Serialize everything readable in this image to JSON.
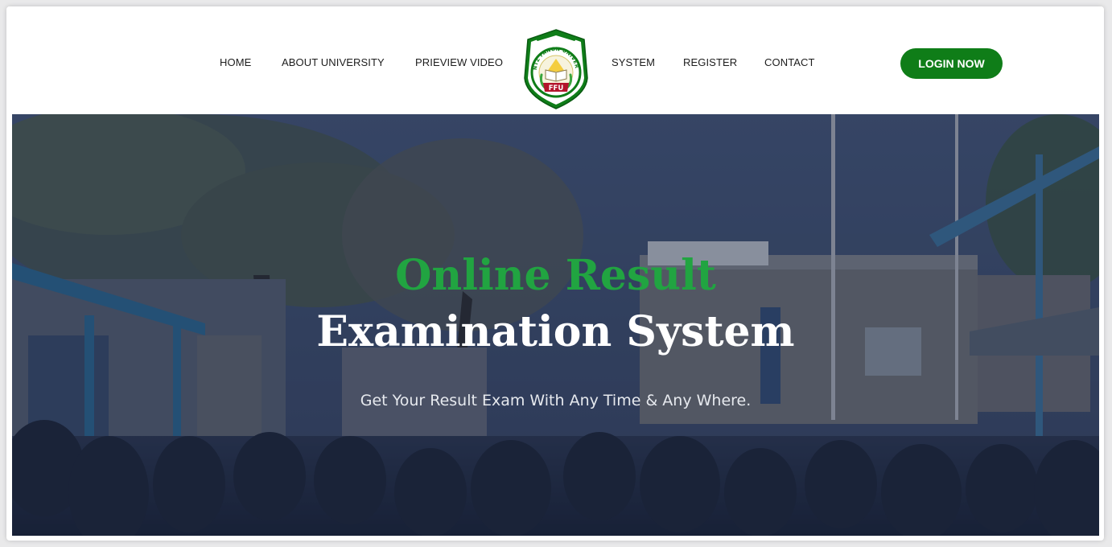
{
  "nav": {
    "home": "HOME",
    "about": "ABOUT UNIVERSITY",
    "preview": "PRIEVIEW VIDEO",
    "system": "SYSTEM",
    "register": "REGISTER",
    "contact": "CONTACT"
  },
  "logo": {
    "arc_text": "FRANTZ FANON UNIVERSITY",
    "initials": "FFU",
    "icon": "university-crest-icon"
  },
  "login_button": "LOGIN NOW",
  "hero": {
    "title_line1": "Online Result",
    "title_line2": "Examination System",
    "subtitle": "Get Your Result Exam With Any Time & Any Where.",
    "background": "campus-ceremony-photo"
  },
  "colors": {
    "accent_green": "#0f7d18",
    "title_green": "#21a441",
    "overlay": "#1b2540"
  }
}
